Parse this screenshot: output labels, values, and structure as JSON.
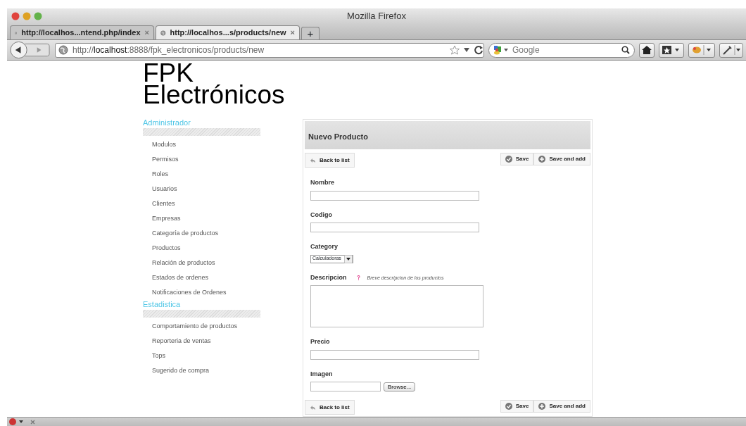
{
  "window": {
    "title": "Mozilla Firefox"
  },
  "tabs": [
    {
      "label": "http://localhos...ntend.php/index",
      "close": "×",
      "selected": false
    },
    {
      "label": "http://localhos...s/products/new",
      "close": "×",
      "selected": true
    }
  ],
  "new_tab_button": "+",
  "address_bar": {
    "url": "http://**localhost**:8888/fpk_electronicos/products/new"
  },
  "search": {
    "placeholder": "Google"
  },
  "logo": [
    "FPK",
    "Electrónicos"
  ],
  "sidebar": [
    {
      "title": "Administrador",
      "items": [
        "Modulos",
        "Permisos",
        "Roles",
        "Usuarios",
        "Clientes",
        "Empresas",
        "Categoría de productos",
        "Productos",
        "Relación de productos",
        "Estados de ordenes",
        "Notificaciones de Ordenes"
      ]
    },
    {
      "title": "Estadistica",
      "items": [
        "Comportamiento de productos",
        "Reporteria de ventas",
        "Tops",
        "Sugerido de compra"
      ]
    }
  ],
  "form": {
    "title": "Nuevo Producto",
    "top_actions": {
      "back": "Back to list",
      "save": "Save",
      "save_add": "Save and add"
    },
    "bottom_actions": {
      "back": "Back to list",
      "save": "Save",
      "save_add": "Save and add"
    },
    "fields": [
      {
        "kind": "text",
        "label": "Nombre"
      },
      {
        "kind": "text",
        "label": "Codigo"
      },
      {
        "kind": "select",
        "label": "Category",
        "value": "Calculadoras"
      },
      {
        "kind": "textarea",
        "label": "Descripcion",
        "help": "Breve descripcion de los productos"
      },
      {
        "kind": "text",
        "label": "Precio"
      },
      {
        "kind": "file",
        "label": "Imagen",
        "button": "Browse..."
      }
    ]
  }
}
